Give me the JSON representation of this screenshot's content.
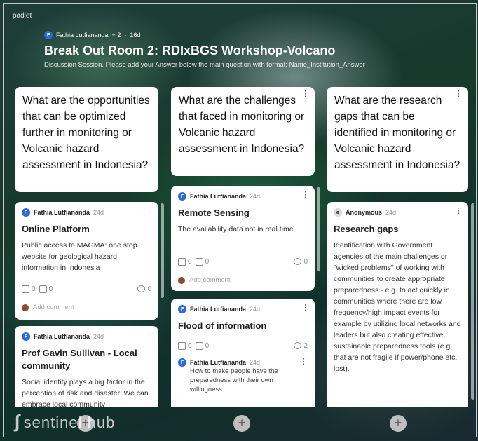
{
  "app": {
    "logo": "padlet",
    "watermark": "sentinel hub"
  },
  "board": {
    "author": "Fathia Lutfiananda",
    "author_initial": "F",
    "collaborators": "+ 2",
    "separator": "·",
    "age": "16d",
    "title": "Break Out Room 2: RDIxBGS Workshop-Volcano",
    "description": "Discussion Session. Please add your Answer below the main question with format: Name_Institution_Answer"
  },
  "columns": [
    {
      "question": "What are the opportunities that can be optimized further in monitoring or Volcanic hazard assessment in Indonesia?",
      "posts": [
        {
          "author": "Fathia Lutfiananda",
          "initial": "F",
          "age": "24d",
          "title": "Online Platform",
          "body": "Public access to MAGMA: one stop website for geological hazard information in Indonesia",
          "likes": "0",
          "dislikes": "0",
          "comments": "0",
          "add_comment": "Add comment"
        },
        {
          "author": "Fathia Lutfiananda",
          "initial": "F",
          "age": "24d",
          "title": "Prof Gavin Sullivan - Local community",
          "body": "Social identity plays a big factor in the perception of risk and disaster. We can embrace local community"
        }
      ]
    },
    {
      "question": "What are the challenges that faced in monitoring or Volcanic hazard assessment in Indonesia?",
      "posts": [
        {
          "author": "Fathia Lutfiananda",
          "initial": "F",
          "age": "24d",
          "title": "Remote Sensing",
          "body": "The availability data not in real time",
          "likes": "0",
          "dislikes": "0",
          "comments": "0",
          "add_comment": "Add comment"
        },
        {
          "author": "Fathia Lutfiananda",
          "initial": "F",
          "age": "24d",
          "title": "Flood of information",
          "likes": "0",
          "dislikes": "0",
          "comments": "2",
          "sub_comment": {
            "author": "Fathia Lutfiananda",
            "initial": "F",
            "age": "24d",
            "text": "How to make people have the preparedness with their own willingness"
          }
        }
      ]
    },
    {
      "question": "What are the research gaps that can be identified in monitoring or Volcanic hazard assessment in Indonesia?",
      "posts": [
        {
          "author": "Anonymous",
          "initial": "☻",
          "age": "24d",
          "title": "Research gaps",
          "body": "Identification with Government agencies of the main challenges or \"wicked problems\" of working with communities to create appropriate preparedness - e.g. to act quickly in communities where there are low frequency/high impact events for example by utilizing local networks and leaders but also creating effective, sustainable preparedness tools (e.g., that are not fragile if power/phone etc. lost)."
        }
      ]
    }
  ],
  "icons": {
    "more": "more-vertical-icon",
    "like": "thumbs-up-icon",
    "dislike": "thumbs-down-icon",
    "comment": "comment-icon",
    "add": "plus-icon"
  },
  "add_label": "+"
}
